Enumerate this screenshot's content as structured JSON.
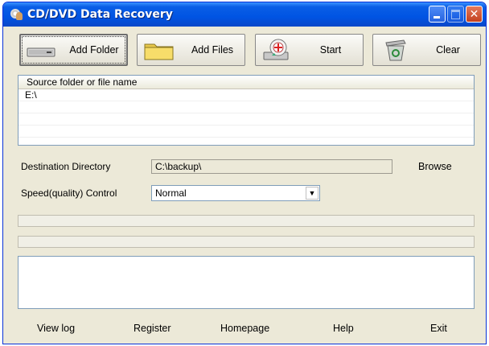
{
  "window": {
    "title": "CD/DVD Data Recovery"
  },
  "toolbar": {
    "add_folder": "Add Folder",
    "add_files": "Add Files",
    "start": "Start",
    "clear": "Clear"
  },
  "source_list": {
    "header": "Source folder or file name",
    "items": [
      "E:\\"
    ]
  },
  "destination": {
    "label": "Destination Directory",
    "value": "C:\\backup\\",
    "browse": "Browse"
  },
  "speed": {
    "label": "Speed(quality) Control",
    "selected": "Normal"
  },
  "footer": {
    "view_log": "View log",
    "register": "Register",
    "homepage": "Homepage",
    "help": "Help",
    "exit": "Exit"
  }
}
